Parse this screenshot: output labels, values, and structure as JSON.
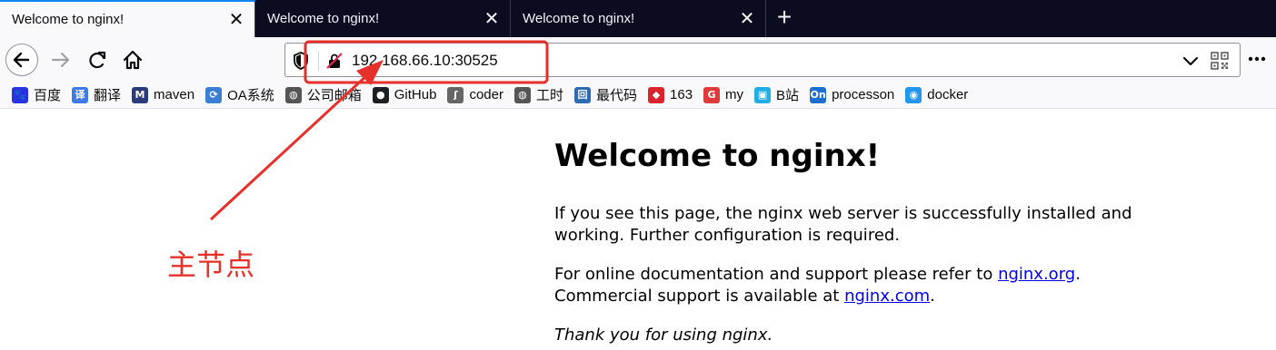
{
  "tabs": [
    {
      "title": "Welcome to nginx!",
      "close": "✕"
    },
    {
      "title": "Welcome to nginx!",
      "close": "✕"
    },
    {
      "title": "Welcome to nginx!",
      "close": "✕"
    }
  ],
  "new_tab": "+",
  "url": "192.168.66.10:30525",
  "bookmarks": [
    {
      "label": "百度",
      "icon": "baidu-icon",
      "color": "#2932e1",
      "glyph": "🐾"
    },
    {
      "label": "翻译",
      "icon": "translate-icon",
      "color": "#3f7be6",
      "glyph": "译"
    },
    {
      "label": "maven",
      "icon": "maven-icon",
      "color": "#2a3a7a",
      "glyph": "M"
    },
    {
      "label": "OA系统",
      "icon": "oa-icon",
      "color": "#3b7fd4",
      "glyph": "⟳"
    },
    {
      "label": "公司邮箱",
      "icon": "globe-icon",
      "color": "#555555",
      "glyph": "◍"
    },
    {
      "label": "GitHub",
      "icon": "github-icon",
      "color": "#1b1f23",
      "glyph": "●"
    },
    {
      "label": "coder",
      "icon": "coder-icon",
      "color": "#666666",
      "glyph": "ʃ"
    },
    {
      "label": "工时",
      "icon": "globe-icon",
      "color": "#555555",
      "glyph": "◍"
    },
    {
      "label": "最代码",
      "icon": "zuidaima-icon",
      "color": "#2d6bb5",
      "glyph": "回"
    },
    {
      "label": "163",
      "icon": "netease-icon",
      "color": "#d9232d",
      "glyph": "◆"
    },
    {
      "label": "my",
      "icon": "my-icon",
      "color": "#e03a3a",
      "glyph": "G"
    },
    {
      "label": "B站",
      "icon": "bilibili-icon",
      "color": "#23ade5",
      "glyph": "▣"
    },
    {
      "label": "processon",
      "icon": "processon-icon",
      "color": "#1f6fd0",
      "glyph": "On"
    },
    {
      "label": "docker",
      "icon": "docker-icon",
      "color": "#2496ed",
      "glyph": "◉"
    }
  ],
  "page": {
    "heading": "Welcome to nginx!",
    "para1": "If you see this page, the nginx web server is successfully installed and working. Further configuration is required.",
    "para2_prefix": "For online documentation and support please refer to ",
    "link1": "nginx.org",
    "para2_mid": ".",
    "para2_line2_prefix": "Commercial support is available at ",
    "link2": "nginx.com",
    "para2_suffix": ".",
    "thanks": "Thank you for using nginx."
  },
  "annotation": {
    "label": "主节点",
    "color": "#e8302a"
  },
  "colors": {
    "tab_strip": "#0c0c21",
    "active_tab_accent": "#0a84ff",
    "toolbar": "#f9f9fb",
    "link": "#0000ee"
  }
}
